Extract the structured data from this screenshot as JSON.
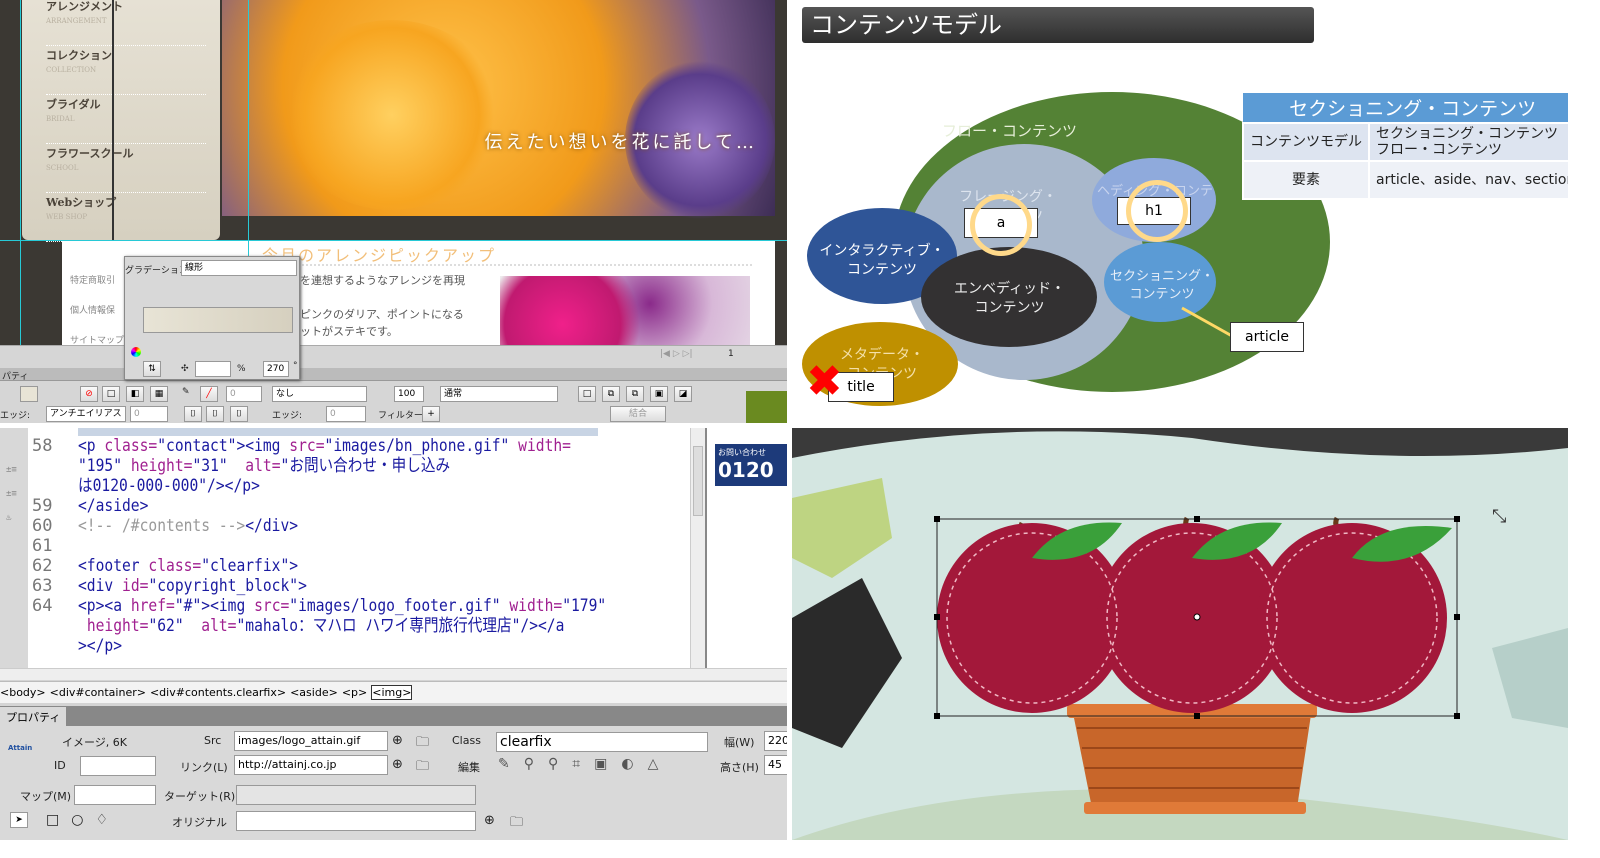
{
  "top_left": {
    "nav_items": [
      {
        "jp": "アレンジメント",
        "en": "ARRANGEMENT"
      },
      {
        "jp": "コレクション",
        "en": "COLLECTION"
      },
      {
        "jp": "ブライダル",
        "en": "BRIDAL"
      },
      {
        "jp": "フラワースクール",
        "en": "SCHOOL"
      },
      {
        "jp": "Webショップ",
        "en": "WEB SHOP"
      }
    ],
    "hero_text": "伝えたい想いを花に託して…",
    "section_heading": "今月のアレンジピックアップ",
    "side_links": [
      "特定商取引",
      "個人情報保",
      "サイトマップ"
    ],
    "body_lines": [
      "を連想するようなアレンジを再現",
      "ピンクのダリア、ポイントになる",
      "ットがステキです。"
    ],
    "page_number": "1",
    "gradient_panel": {
      "label": "グラデーション:",
      "type_value": "線形",
      "percent_label": "%",
      "angle_value": "270",
      "degree": "°"
    },
    "toolbar": {
      "panel_tab": "パティ",
      "edge_label": "エッジ:",
      "edge_value": "アンチエイリアス",
      "edge_num": "0",
      "stroke_num": "0",
      "stroke_style": "なし",
      "edge2_label": "エッジ:",
      "edge2_num": "0",
      "opacity": "100",
      "blend": "通常",
      "filter_label": "フィルター:",
      "combine_button": "結合"
    }
  },
  "top_right": {
    "slide_title": "コンテンツモデル",
    "diagram": {
      "flow": "フロー・コンテンツ",
      "phrasing": "フレージング・コンテンツ",
      "heading": "ヘディング・コンテンツ",
      "interactive": "インタラクティブ・\nコンテンツ",
      "embedded": "エンベディッド・\nコンテンツ",
      "sectioning": "セクショニング・\nコンテンツ",
      "metadata": "メタデータ・\nコンテンツ",
      "tag_a": "a",
      "tag_h1": "h1",
      "tag_article": "article",
      "tag_title": "title"
    },
    "table": {
      "header": "セクショニング・コンテンツ",
      "rows": [
        {
          "label": "コンテンツモデル",
          "value": "セクショニング・コンテンツ\nフロー・コンテンツ"
        },
        {
          "label": "要素",
          "value": "article、aside、nav、section"
        }
      ]
    }
  },
  "bottom_left": {
    "code_lines": [
      {
        "n": "58",
        "html": "<span class='tag'>&lt;p </span><span class='attr'>class=</span><span class='val'>\"contact\"</span><span class='tag'>&gt;&lt;img </span><span class='attr'>src=</span><span class='val'>\"images/bn_phone.gif\"</span> <span class='attr'>width=</span>"
      },
      {
        "n": "",
        "html": "<span class='val'>\"195\"</span> <span class='attr'>height=</span><span class='val'>\"31\"</span>  <span class='attr'>alt=</span><span class='val'>\"お問い合わせ・申し込み</span>"
      },
      {
        "n": "",
        "html": "<span class='val'>は0120-000-000\"</span><span class='tag'>/&gt;&lt;/p&gt;</span>"
      },
      {
        "n": "59",
        "html": "<span class='tag'>&lt;/aside&gt;</span>"
      },
      {
        "n": "60",
        "html": "<span class='cm'>&lt;!-- /#contents --&gt;</span><span class='tag'>&lt;/div&gt;</span>"
      },
      {
        "n": "61",
        "html": ""
      },
      {
        "n": "62",
        "html": "<span class='tag'>&lt;footer </span><span class='attr'>class=</span><span class='val'>\"clearfix\"</span><span class='tag'>&gt;</span>"
      },
      {
        "n": "63",
        "html": "<span class='tag'>&lt;div </span><span class='attr'>id=</span><span class='val'>\"copyright_block\"</span><span class='tag'>&gt;</span>"
      },
      {
        "n": "64",
        "html": "<span class='tag'>&lt;p&gt;&lt;a </span><span class='attr'>href=</span><span class='val'>\"#\"</span><span class='tag'>&gt;&lt;img </span><span class='attr'>src=</span><span class='val'>\"images/logo_footer.gif\"</span> <span class='attr'>width=</span><span class='val'>\"179\"</span>"
      },
      {
        "n": "",
        "html": " <span class='attr'>height=</span><span class='val'>\"62\"</span>  <span class='attr'>alt=</span><span class='val'>\"mahalo：マハロ ハワイ専門旅行代理店\"</span><span class='tag'>/&gt;&lt;/a</span>"
      },
      {
        "n": "",
        "html": "<span class='tag'>&gt;&lt;/p&gt;</span>"
      }
    ],
    "preview_text": "お問い合わせ",
    "preview_num": "0120",
    "breadcrumb": [
      "<body>",
      "<div#container>",
      "<div#contents.clearfix>",
      "<aside>",
      "<p>",
      "<img>"
    ],
    "properties": {
      "tab": "プロパティ",
      "image_info": "イメージ, 6K",
      "logo": "Attain",
      "id_label": "ID",
      "src_label": "Src",
      "src_value": "images/logo_attain.gif",
      "link_label": "リンク(L)",
      "link_value": "http://attainj.co.jp",
      "class_label": "Class",
      "class_value": "clearfix",
      "edit_label": "編集",
      "width_label": "幅(W)",
      "width_value": "220",
      "height_label": "高さ(H)",
      "height_value": "45",
      "map_label": "マップ(M)",
      "target_label": "ターゲット(R)",
      "original_label": "オリジナル"
    }
  }
}
